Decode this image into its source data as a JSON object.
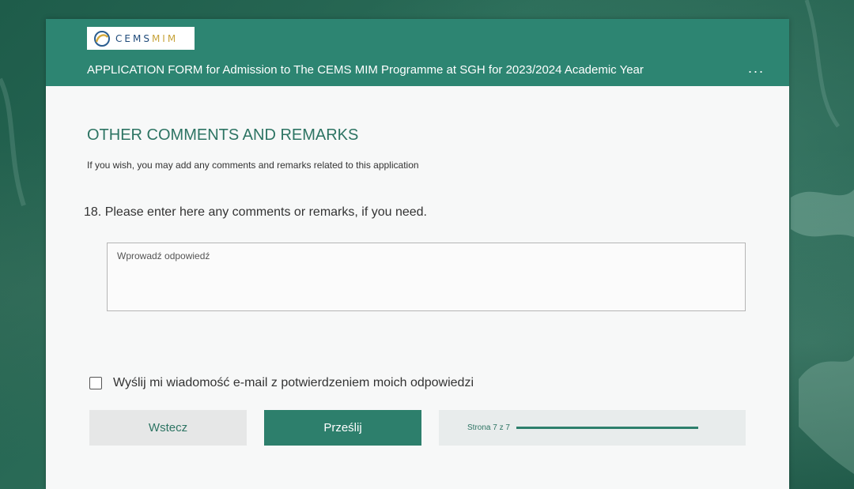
{
  "header": {
    "logo": {
      "cems": "CEMS",
      "mim": "MIM"
    },
    "title": "APPLICATION FORM for Admission to The CEMS MIM Programme at SGH for 2023/2024 Academic Year",
    "more_icon": "more-horizontal-icon",
    "more_label": "..."
  },
  "section": {
    "title": "OTHER COMMENTS AND REMARKS",
    "description": "If you wish, you may add any comments and remarks related to this application"
  },
  "question": {
    "label": "18. Please enter here any comments or remarks, if you need.",
    "value": "",
    "placeholder": "Wprowadź odpowiedź"
  },
  "email_receipt": {
    "label": "Wyślij mi wiadomość e-mail z potwierdzeniem moich odpowiedzi",
    "checked": false
  },
  "nav": {
    "back_label": "Wstecz",
    "submit_label": "Prześlij",
    "page_indicator": "Strona 7 z 7",
    "progress": 1.0
  },
  "colors": {
    "accent": "#2d8572",
    "button": "#2d7f6c",
    "title_text": "#2d7463"
  }
}
